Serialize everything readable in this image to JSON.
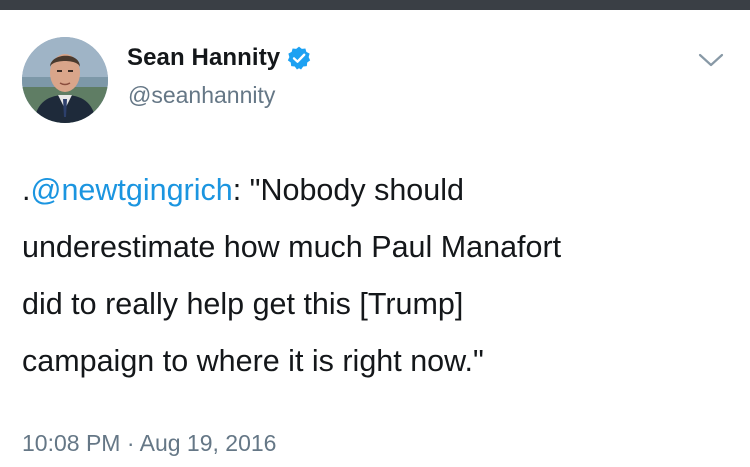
{
  "tweet": {
    "author": {
      "display_name": "Sean Hannity",
      "handle": "@seanhannity",
      "verified": true,
      "avatar_icon": "profile-photo"
    },
    "text": {
      "prefix": ".",
      "mention": "@newtgingrich",
      "after_mention": ": \"Nobody should",
      "rest": "underestimate how much Paul Manafort\ndid to really help get this [Trump]\ncampaign to where it is right now.\""
    },
    "timestamp": "10:08 PM · Aug 19, 2016",
    "menu_icon": "chevron-down-icon"
  },
  "colors": {
    "top_bar": "#3a3f45",
    "text": "#14171a",
    "secondary": "#657786",
    "link": "#1b95e0",
    "verified": "#1da1f2"
  }
}
